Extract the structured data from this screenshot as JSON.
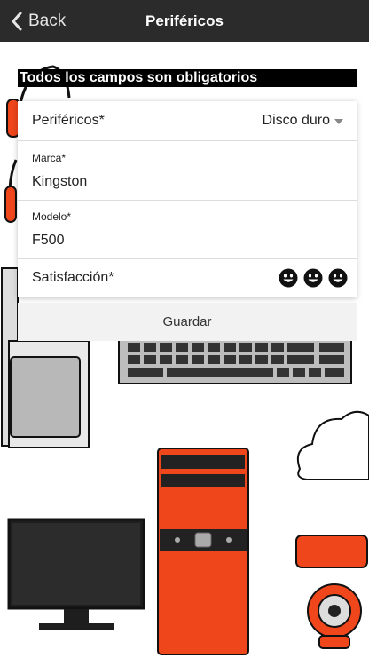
{
  "header": {
    "back_label": "Back",
    "title": "Periféricos"
  },
  "notice": "Todos los campos son obligatorios",
  "form": {
    "perifericos_label": "Periféricos*",
    "perifericos_value": "Disco duro",
    "marca_label": "Marca*",
    "marca_value": "Kingston",
    "modelo_label": "Modelo*",
    "modelo_value": "F500",
    "satisfaccion_label": "Satisfacción*",
    "satisfaccion_options": [
      "happy-face",
      "happy-face",
      "happy-face"
    ]
  },
  "save_label": "Guardar",
  "colors": {
    "header_bg": "#2b2b2b",
    "accent_orange": "#f0461b",
    "button_bg": "#f2f2f2"
  }
}
